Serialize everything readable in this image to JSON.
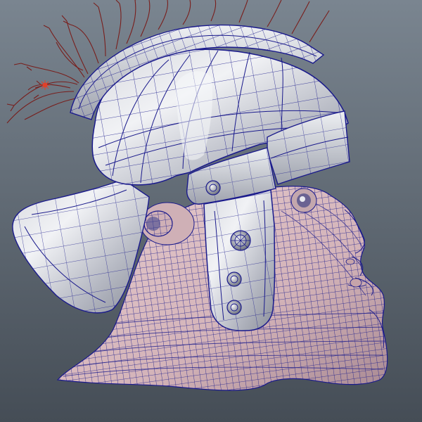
{
  "viewport": {
    "background_top": "#7a8590",
    "background_bottom": "#4a535c",
    "wire_color": "#1a1a8c",
    "skin_color": "#d9bcc0",
    "skin_shade": "#b89aa2",
    "metal_light": "#e9eaee",
    "metal_mid": "#b9bcc6",
    "metal_dark": "#7c808c",
    "plume_color": "#7a1410",
    "pivot_color": "#e0402a"
  },
  "icons": {
    "pivot": "pivot-manipulator-icon",
    "rivet": "rivet-bolt-icon"
  }
}
